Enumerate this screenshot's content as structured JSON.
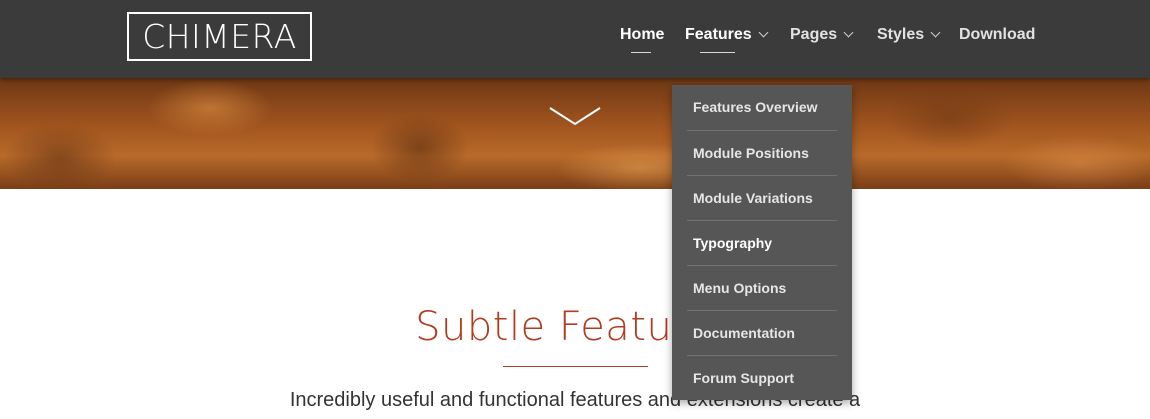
{
  "brand": {
    "logo_text": "CHIMERA"
  },
  "nav": {
    "items": [
      {
        "label": "Home",
        "active": true,
        "has_submenu": false
      },
      {
        "label": "Features",
        "active": true,
        "has_submenu": true
      },
      {
        "label": "Pages",
        "active": false,
        "has_submenu": true
      },
      {
        "label": "Styles",
        "active": false,
        "has_submenu": true
      },
      {
        "label": "Download",
        "active": false,
        "has_submenu": false
      }
    ]
  },
  "dropdown": {
    "parent": "Features",
    "items": [
      {
        "label": "Features Overview"
      },
      {
        "label": "Module Positions"
      },
      {
        "label": "Module Variations"
      },
      {
        "label": "Typography",
        "current": true
      },
      {
        "label": "Menu Options"
      },
      {
        "label": "Documentation"
      },
      {
        "label": "Forum Support"
      }
    ]
  },
  "hero": {
    "icon": "chevron-down-icon"
  },
  "content": {
    "title": "Subtle Features",
    "intro": "Incredibly useful and functional features and extensions create a"
  },
  "colors": {
    "header_bg": "#3b3b3b",
    "dropdown_bg": "#565656",
    "accent": "#b23b21"
  }
}
